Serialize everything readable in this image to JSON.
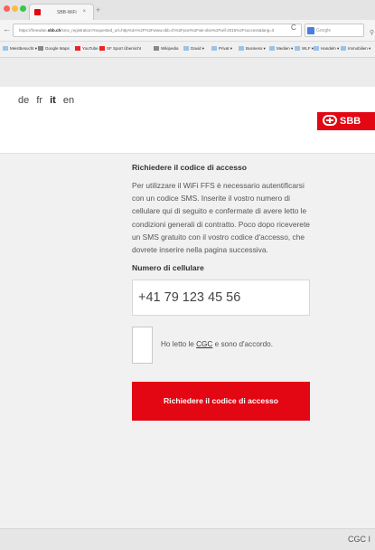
{
  "browser": {
    "tab_title": "SBB-WiFi",
    "tab_close": "×",
    "new_tab": "+",
    "back": "←",
    "url_prefix": "https://freewlan.",
    "url_domain": "sbb.ch",
    "url_rest": "/smx_registration?requested_url=http%3A%2F%2Fwww.sbb.ch%2Fport%2Fwk-skin%2Fwif-2015%2Fsuccess&lang=it",
    "reload": "C",
    "search_placeholder": "Google",
    "bookmarks": [
      {
        "label": "Meistbesucht ▾"
      },
      {
        "label": "Google Maps"
      },
      {
        "label": "YouTube"
      },
      {
        "label": "SF Sport Übersicht"
      },
      {
        "label": "Wikipedia"
      },
      {
        "label": "David ▾"
      },
      {
        "label": "Privat ▾"
      },
      {
        "label": "Business ▾"
      },
      {
        "label": "Medien ▾"
      },
      {
        "label": "WLF ▾"
      },
      {
        "label": "Handeln ▾"
      },
      {
        "label": "Immobilien ▾"
      }
    ]
  },
  "page": {
    "languages": [
      "de",
      "fr",
      "it",
      "en"
    ],
    "logo_text": "SBB",
    "title": "Richiedere il codice di accesso",
    "intro": "Per utilizzare il WiFi FFS è necessario autentificarsi con un codice SMS. Inserite il vostro numero di cellulare qui di seguito e confermate di avere letto le condizioni generali di contratto. Poco dopo riceverete un SMS gratuito con il vostro codice d'accesso, che dovrete inserire nella pagina successiva.",
    "phone_label": "Numero di cellulare",
    "phone_value": "+41 79 123 45 56",
    "check_before": "Ho letto le ",
    "check_link": "CGC",
    "check_after": " e sono d'accordo.",
    "submit_label": "Richiedere il codice di accesso",
    "footer_text": "CGC  I"
  }
}
